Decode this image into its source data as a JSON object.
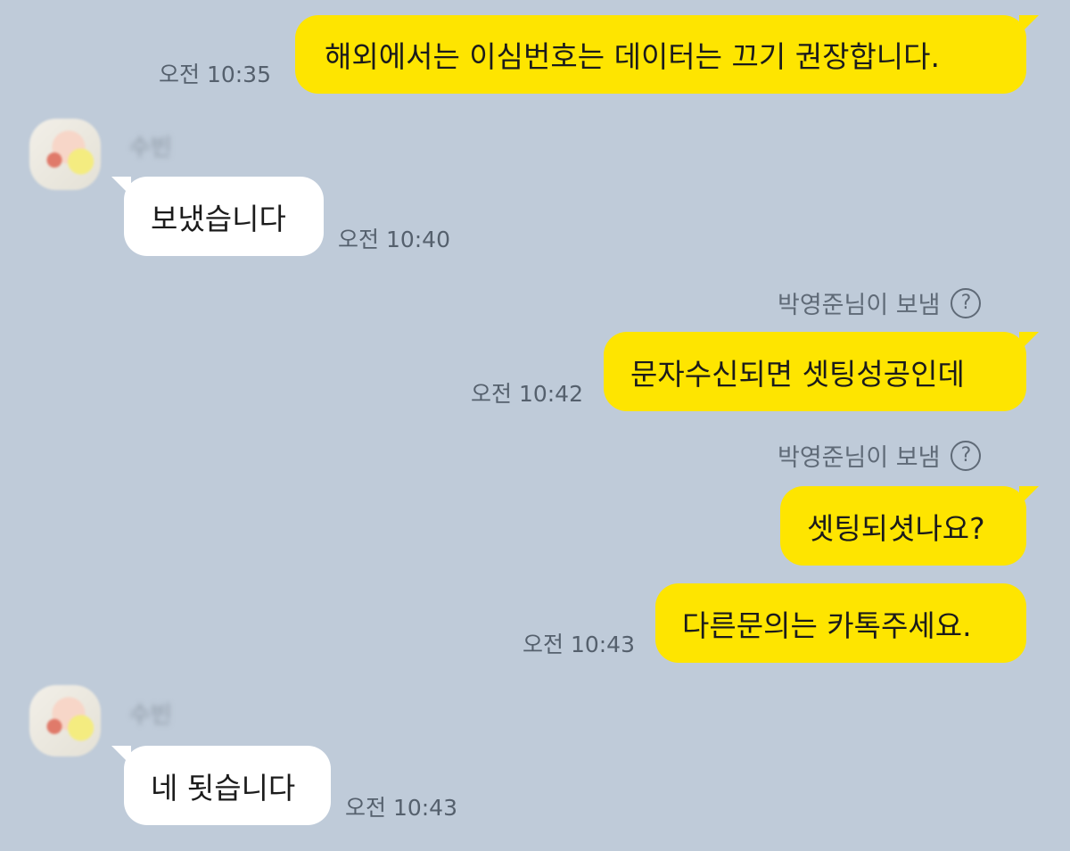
{
  "messages": [
    {
      "id": "m1",
      "side": "right",
      "text": "해외에서는 이심번호는 데이터는 끄기 권장합니다.",
      "time": "오전 10:35"
    },
    {
      "id": "m2",
      "side": "left",
      "sender": "수빈",
      "text": "보냈습니다",
      "time": "오전 10:40"
    },
    {
      "id": "m3",
      "side": "right",
      "note": "박영준님이 보냄",
      "text": "문자수신되면 셋팅성공인데",
      "time": "오전 10:42"
    },
    {
      "id": "m4",
      "side": "right",
      "note": "박영준님이 보냄",
      "text": "셋팅되셧나요?",
      "time": ""
    },
    {
      "id": "m5",
      "side": "right",
      "text": "다른문의는 카톡주세요.",
      "time": "오전 10:43"
    },
    {
      "id": "m6",
      "side": "left",
      "sender": "수빈",
      "text": "네 됫습니다",
      "time": "오전 10:43"
    }
  ],
  "icons": {
    "help": "?"
  },
  "colors": {
    "background": "#bfcbd9",
    "my_bubble": "#fee500",
    "their_bubble": "#ffffff"
  }
}
